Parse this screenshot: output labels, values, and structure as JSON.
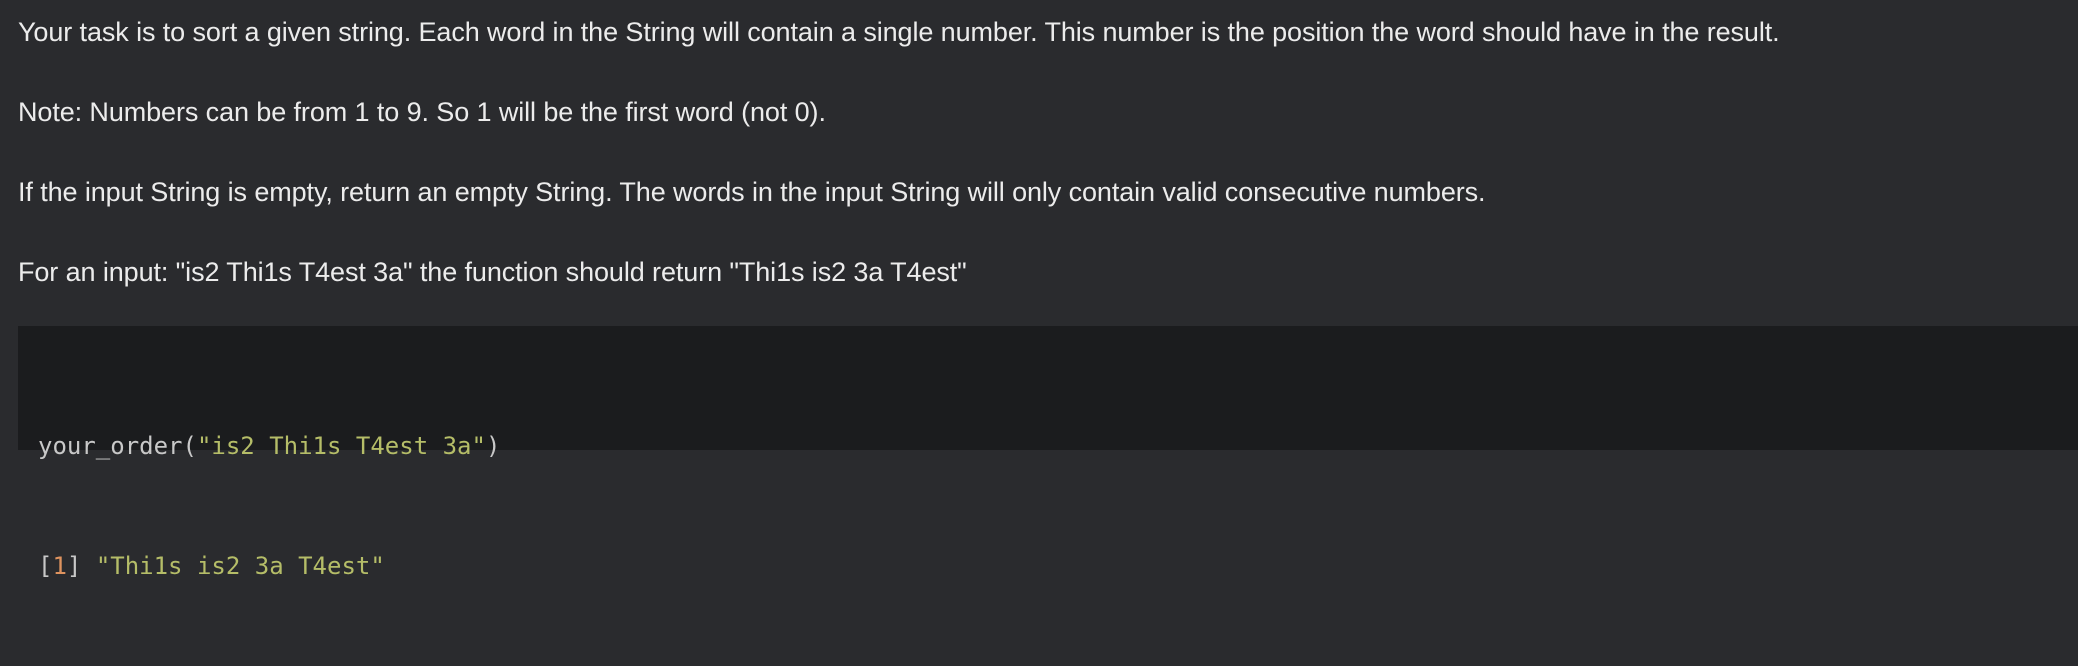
{
  "description": {
    "paragraphs": [
      "Your task is to sort a given string. Each word in the String will contain a single number. This number is the position the word should have in the result.",
      "Note: Numbers can be from 1 to 9. So 1 will be the first word (not 0).",
      "If the input String is empty, return an empty String. The words in the input String will only contain valid consecutive numbers.",
      "For an input: \"is2 Thi1s T4est 3a\" the function should return \"Thi1s is2 3a T4est\""
    ]
  },
  "code_example": {
    "line1": {
      "function_call": "your_order(",
      "argument": "\"is2 Thi1s T4est 3a\"",
      "close": ")"
    },
    "line2": {
      "index_open": "[",
      "index_value": "1",
      "index_close": "]",
      "result": "\"Thi1s is2 3a T4est\""
    }
  },
  "colors": {
    "background": "#2a2b2e",
    "code_background": "#1b1c1e",
    "text": "#ececec",
    "code_string": "#b5bd68",
    "code_number": "#de935f"
  }
}
